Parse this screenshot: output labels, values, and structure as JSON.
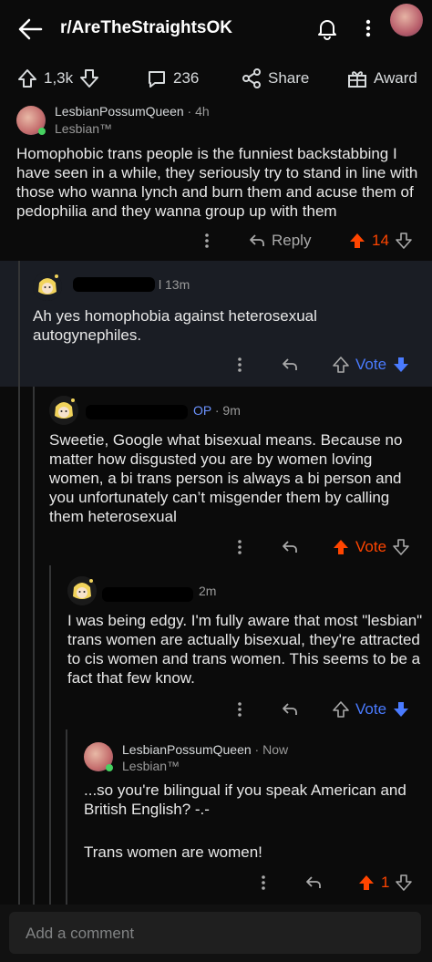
{
  "header": {
    "subreddit": "r/AreTheStraightsOK",
    "back_icon": "back-arrow-icon",
    "bell_icon": "bell-icon",
    "menu_icon": "kebab-menu-icon"
  },
  "post_actions": {
    "upvotes": "1,3k",
    "comments": "236",
    "share": "Share",
    "award": "Award"
  },
  "comments": [
    {
      "user": "LesbianPossumQueen",
      "time": "· 4h",
      "flair": "Lesbian™",
      "body": "Homophobic trans people is the funniest backstabbing I have seen in a while, they seriously try to stand in line with those who wanna lynch and burn them and acuse them of pedophilia and they wanna group up with them",
      "reply": "Reply",
      "score": "14"
    },
    {
      "user_visible": "l",
      "time": "13m",
      "body": "Ah yes homophobia against heterosexual autogynephiles.",
      "vote": "Vote"
    },
    {
      "user_visible": "",
      "op": "OP",
      "time": "· 9m",
      "body": "Sweetie, Google what bisexual means. Because no matter how disgusted you are by women loving women, a bi trans person is always a bi person and you unfortunately can’t misgender them by calling them heterosexual",
      "vote": "Vote"
    },
    {
      "user_visible": "",
      "time": "2m",
      "body": "I was being edgy. I'm fully aware that most \"lesbian\" trans women are actually bisexual, they're attracted to cis women and trans women. This seems to be a fact that few know.",
      "vote": "Vote"
    },
    {
      "user": "LesbianPossumQueen",
      "time": "· Now",
      "flair": "Lesbian™",
      "body1": "...so you're bilingual if you speak American and British English? -.-",
      "body2": "Trans women are women!",
      "score": "1"
    }
  ],
  "composer": {
    "placeholder": "Add a comment"
  },
  "colors": {
    "background": "#0b0b0b",
    "highlight": "#1a1d24",
    "upvote": "#ff4500",
    "downvote": "#4a7bff",
    "op": "#6c93ff"
  }
}
